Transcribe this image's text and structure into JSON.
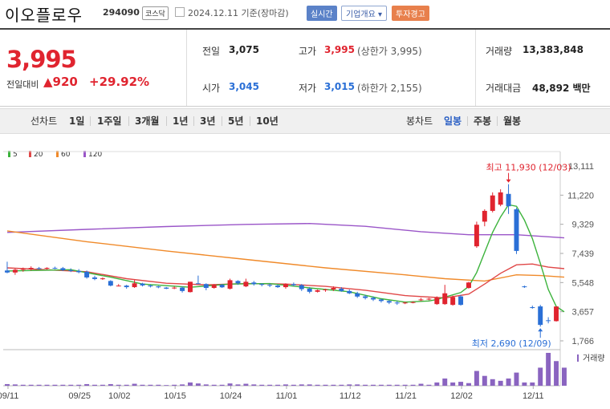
{
  "header": {
    "name": "이오플로우",
    "code": "294090",
    "market": "코스닥",
    "date": "2024.12.11",
    "date_suffix": "기준(장마감)",
    "realtime_label": "실시간",
    "company_label": "기업개요",
    "warning_label": "투자경고"
  },
  "summary": {
    "price": "3,995",
    "change_label": "전일대비",
    "change": "920",
    "change_pct": "+29.92%",
    "prev_close_label": "전일",
    "prev_close": "3,075",
    "high_label": "고가",
    "high": "3,995",
    "upper_limit": "(상한가 3,995)",
    "volume_label": "거래량",
    "volume": "13,383,848",
    "open_label": "시가",
    "open": "3,045",
    "low_label": "저가",
    "low": "3,015",
    "lower_limit": "(하한가 2,155)",
    "amount_label": "거래대금",
    "amount": "48,892",
    "amount_unit": "백만"
  },
  "toolbar": {
    "line_label": "선차트",
    "line_periods": [
      "1일",
      "1주일",
      "3개월",
      "1년",
      "3년",
      "5년",
      "10년"
    ],
    "candle_label": "봉차트",
    "candle_periods": [
      "일봉",
      "주봉",
      "월봉"
    ],
    "active_candle": "일봉"
  },
  "colors": {
    "up": "#e0242f",
    "down": "#2a6fd6",
    "ma5": "#3cb33c",
    "ma20": "#e04848",
    "ma60": "#f08a2a",
    "ma120": "#9a55c8",
    "volume": "#8a64c0"
  },
  "chart_data": {
    "type": "candlestick",
    "legend": [
      "5",
      "20",
      "60",
      "120"
    ],
    "y_ticks": [
      "13,111",
      "11,220",
      "9,329",
      "7,439",
      "5,548",
      "3,657",
      "1,766"
    ],
    "ylim": [
      1766,
      13111
    ],
    "x_ticks": [
      "09/11",
      "09/25",
      "10/02",
      "10/15",
      "10/24",
      "11/01",
      "11/12",
      "11/21",
      "12/02",
      "12/11"
    ],
    "max_annotation": "최고 11,930 (12/03)",
    "min_annotation": "최저 2,690 (12/09)",
    "volume_label": "거래량",
    "candles": [
      {
        "o": 6330,
        "h": 6900,
        "l": 6150,
        "c": 6200
      },
      {
        "o": 6200,
        "h": 6450,
        "l": 6050,
        "c": 6380
      },
      {
        "o": 6380,
        "h": 6520,
        "l": 6250,
        "c": 6430
      },
      {
        "o": 6420,
        "h": 6600,
        "l": 6330,
        "c": 6500
      },
      {
        "o": 6480,
        "h": 6560,
        "l": 6390,
        "c": 6440
      },
      {
        "o": 6470,
        "h": 6540,
        "l": 6380,
        "c": 6500
      },
      {
        "o": 6500,
        "h": 6580,
        "l": 6420,
        "c": 6480
      },
      {
        "o": 6480,
        "h": 6560,
        "l": 6300,
        "c": 6350
      },
      {
        "o": 6350,
        "h": 6470,
        "l": 6230,
        "c": 6300
      },
      {
        "o": 6300,
        "h": 6420,
        "l": 6150,
        "c": 6220
      },
      {
        "o": 6250,
        "h": 6330,
        "l": 5800,
        "c": 5880
      },
      {
        "o": 5880,
        "h": 5990,
        "l": 5700,
        "c": 5780
      },
      {
        "o": 5790,
        "h": 5880,
        "l": 5720,
        "c": 5820
      },
      {
        "o": 5650,
        "h": 5700,
        "l": 5300,
        "c": 5350
      },
      {
        "o": 5350,
        "h": 5450,
        "l": 5300,
        "c": 5350
      },
      {
        "o": 5350,
        "h": 5400,
        "l": 5150,
        "c": 5250
      },
      {
        "o": 5250,
        "h": 5700,
        "l": 5200,
        "c": 5500
      },
      {
        "o": 5480,
        "h": 5530,
        "l": 5300,
        "c": 5360
      },
      {
        "o": 5360,
        "h": 5420,
        "l": 5230,
        "c": 5300
      },
      {
        "o": 5300,
        "h": 5330,
        "l": 5180,
        "c": 5240
      },
      {
        "o": 5220,
        "h": 5260,
        "l": 5120,
        "c": 5150
      },
      {
        "o": 5180,
        "h": 5300,
        "l": 5120,
        "c": 5220
      },
      {
        "o": 5220,
        "h": 5300,
        "l": 4900,
        "c": 5000
      },
      {
        "o": 4930,
        "h": 5600,
        "l": 4900,
        "c": 5600
      },
      {
        "o": 5500,
        "h": 6000,
        "l": 5450,
        "c": 5490
      },
      {
        "o": 5450,
        "h": 5500,
        "l": 5050,
        "c": 5200
      },
      {
        "o": 5200,
        "h": 5450,
        "l": 5150,
        "c": 5400
      },
      {
        "o": 5400,
        "h": 5450,
        "l": 5200,
        "c": 5240
      },
      {
        "o": 5150,
        "h": 5800,
        "l": 5100,
        "c": 5700
      },
      {
        "o": 5650,
        "h": 5700,
        "l": 5400,
        "c": 5500
      },
      {
        "o": 5300,
        "h": 5800,
        "l": 5250,
        "c": 5600
      },
      {
        "o": 5550,
        "h": 5650,
        "l": 5350,
        "c": 5450
      },
      {
        "o": 5450,
        "h": 5500,
        "l": 5300,
        "c": 5400
      },
      {
        "o": 5400,
        "h": 5480,
        "l": 5250,
        "c": 5350
      },
      {
        "o": 5350,
        "h": 5420,
        "l": 5200,
        "c": 5250
      },
      {
        "o": 5250,
        "h": 5500,
        "l": 5150,
        "c": 5450
      },
      {
        "o": 5450,
        "h": 5550,
        "l": 5300,
        "c": 5380
      },
      {
        "o": 5380,
        "h": 5450,
        "l": 5000,
        "c": 5120
      },
      {
        "o": 5150,
        "h": 5250,
        "l": 4850,
        "c": 4950
      },
      {
        "o": 4950,
        "h": 5100,
        "l": 4900,
        "c": 5050
      },
      {
        "o": 5050,
        "h": 5150,
        "l": 4950,
        "c": 5100
      },
      {
        "o": 5100,
        "h": 5300,
        "l": 5000,
        "c": 5200
      },
      {
        "o": 5150,
        "h": 5250,
        "l": 4950,
        "c": 5000
      },
      {
        "o": 5000,
        "h": 5100,
        "l": 4800,
        "c": 4850
      },
      {
        "o": 4850,
        "h": 4950,
        "l": 4550,
        "c": 4640
      },
      {
        "o": 4650,
        "h": 4750,
        "l": 4450,
        "c": 4550
      },
      {
        "o": 4550,
        "h": 4650,
        "l": 4350,
        "c": 4450
      },
      {
        "o": 4450,
        "h": 4500,
        "l": 4250,
        "c": 4350
      },
      {
        "o": 4350,
        "h": 4400,
        "l": 4150,
        "c": 4250
      },
      {
        "o": 4250,
        "h": 4350,
        "l": 4100,
        "c": 4230
      },
      {
        "o": 4230,
        "h": 4300,
        "l": 4150,
        "c": 4250
      },
      {
        "o": 4250,
        "h": 4330,
        "l": 4200,
        "c": 4280
      },
      {
        "o": 4400,
        "h": 4550,
        "l": 4350,
        "c": 4450
      },
      {
        "o": 4450,
        "h": 4550,
        "l": 4400,
        "c": 4500
      },
      {
        "o": 4150,
        "h": 4650,
        "l": 4100,
        "c": 4550
      },
      {
        "o": 4150,
        "h": 5400,
        "l": 4100,
        "c": 4850
      },
      {
        "o": 4100,
        "h": 4700,
        "l": 4050,
        "c": 4600
      },
      {
        "o": 4650,
        "h": 4750,
        "l": 4050,
        "c": 4100
      },
      {
        "o": 5200,
        "h": 5600,
        "l": 5150,
        "c": 5550
      },
      {
        "o": 7900,
        "h": 9500,
        "l": 7800,
        "c": 9300
      },
      {
        "o": 9500,
        "h": 10300,
        "l": 9200,
        "c": 10200
      },
      {
        "o": 10200,
        "h": 11400,
        "l": 10100,
        "c": 11200
      },
      {
        "o": 10600,
        "h": 11600,
        "l": 10500,
        "c": 11400
      },
      {
        "o": 11300,
        "h": 11930,
        "l": 10000,
        "c": 10500
      },
      {
        "o": 10300,
        "h": 10400,
        "l": 7400,
        "c": 7600
      },
      {
        "o": 5300,
        "h": 5350,
        "l": 5200,
        "c": 5250
      },
      {
        "o": 3950,
        "h": 4050,
        "l": 3850,
        "c": 3900
      },
      {
        "o": 4000,
        "h": 4100,
        "l": 2690,
        "c": 2800
      },
      {
        "o": 3100,
        "h": 3300,
        "l": 2900,
        "c": 3075
      },
      {
        "o": 3045,
        "h": 3995,
        "l": 3015,
        "c": 3995
      }
    ],
    "ma5": [
      [
        0,
        6300
      ],
      [
        8,
        6380
      ],
      [
        13,
        5900
      ],
      [
        17,
        5450
      ],
      [
        23,
        5240
      ],
      [
        28,
        5450
      ],
      [
        33,
        5480
      ],
      [
        38,
        5200
      ],
      [
        43,
        4950
      ],
      [
        47,
        4500
      ],
      [
        50,
        4280
      ],
      [
        53,
        4350
      ],
      [
        54,
        4450
      ],
      [
        55,
        4600
      ],
      [
        57,
        4900
      ],
      [
        58,
        5300
      ],
      [
        59,
        6200
      ],
      [
        60,
        7500
      ],
      [
        61,
        8800
      ],
      [
        62,
        9800
      ],
      [
        63,
        10600
      ],
      [
        64,
        10500
      ],
      [
        65,
        9600
      ],
      [
        66,
        8400
      ],
      [
        67,
        6800
      ],
      [
        68,
        5100
      ],
      [
        69,
        4000
      ],
      [
        70,
        3650
      ]
    ],
    "ma20": [
      [
        0,
        6500
      ],
      [
        10,
        6250
      ],
      [
        15,
        5800
      ],
      [
        20,
        5500
      ],
      [
        25,
        5400
      ],
      [
        30,
        5480
      ],
      [
        35,
        5450
      ],
      [
        40,
        5300
      ],
      [
        45,
        5050
      ],
      [
        50,
        4700
      ],
      [
        55,
        4550
      ],
      [
        58,
        4800
      ],
      [
        60,
        5450
      ],
      [
        62,
        6150
      ],
      [
        64,
        6700
      ],
      [
        66,
        6750
      ],
      [
        68,
        6550
      ],
      [
        70,
        6450
      ]
    ],
    "ma60": [
      [
        0,
        8900
      ],
      [
        10,
        8200
      ],
      [
        20,
        7600
      ],
      [
        30,
        7050
      ],
      [
        40,
        6500
      ],
      [
        50,
        6050
      ],
      [
        55,
        5800
      ],
      [
        60,
        5650
      ],
      [
        64,
        6050
      ],
      [
        67,
        6000
      ],
      [
        70,
        5900
      ]
    ],
    "ma120": [
      [
        0,
        8800
      ],
      [
        10,
        9000
      ],
      [
        20,
        9180
      ],
      [
        30,
        9320
      ],
      [
        38,
        9380
      ],
      [
        45,
        9200
      ],
      [
        52,
        8850
      ],
      [
        58,
        8650
      ],
      [
        64,
        8650
      ],
      [
        70,
        8450
      ]
    ],
    "volume": [
      0.05,
      0.04,
      0.03,
      0.03,
      0.03,
      0.03,
      0.03,
      0.03,
      0.03,
      0.03,
      0.05,
      0.03,
      0.03,
      0.05,
      0.03,
      0.03,
      0.06,
      0.03,
      0.03,
      0.03,
      0.02,
      0.03,
      0.04,
      0.1,
      0.07,
      0.04,
      0.03,
      0.03,
      0.07,
      0.04,
      0.06,
      0.04,
      0.03,
      0.03,
      0.03,
      0.04,
      0.03,
      0.04,
      0.04,
      0.03,
      0.03,
      0.03,
      0.03,
      0.04,
      0.04,
      0.03,
      0.03,
      0.03,
      0.03,
      0.03,
      0.03,
      0.03,
      0.06,
      0.03,
      0.1,
      0.22,
      0.1,
      0.12,
      0.08,
      0.45,
      0.3,
      0.2,
      0.15,
      0.22,
      0.4,
      0.1,
      0.1,
      0.55,
      1.0,
      0.75,
      0.55
    ]
  }
}
